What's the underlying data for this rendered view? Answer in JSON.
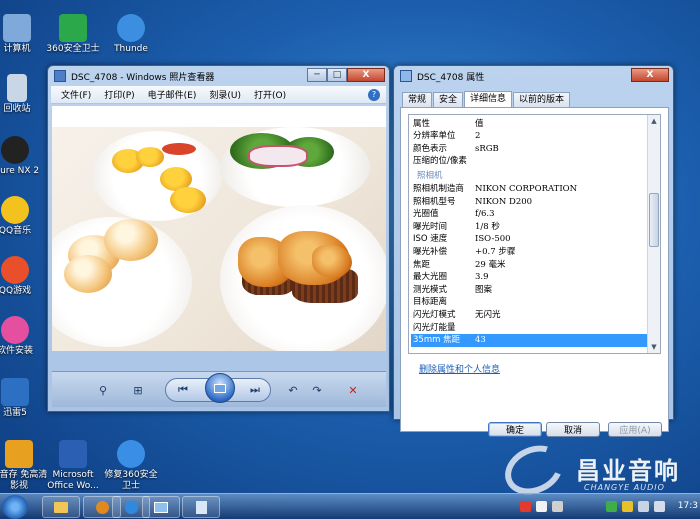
{
  "desktop_icons": [
    {
      "label": "计算机",
      "color": "#7fa9d9"
    },
    {
      "label": "360安全卫士",
      "color": "#2aa84a"
    },
    {
      "label": "Thunde",
      "color": "#3b8ee0"
    },
    {
      "label": "回收站",
      "color": "#c8d6e6"
    },
    {
      "label": "pture NX 2",
      "color": "#222222"
    },
    {
      "label": "QQ音乐",
      "color": "#f4c21f"
    },
    {
      "label": "QQ游戏",
      "color": "#e94f2a"
    },
    {
      "label": "软件安装",
      "color": "#e44fa0"
    },
    {
      "label": "迅雷5",
      "color": "#2d6fc3"
    },
    {
      "label": "暴音存 免高清影视",
      "color": "#e8a020"
    },
    {
      "label": "Microsoft Office Wo...",
      "color": "#2b5fb3"
    },
    {
      "label": "修复360安全卫士",
      "color": "#3a8ee6"
    }
  ],
  "photo_viewer": {
    "title": "DSC_4708 - Windows 照片查看器",
    "menu": [
      "文件(F)",
      "打印(P)",
      "电子邮件(E)",
      "刻录(U)",
      "打开(O)"
    ],
    "help": "?",
    "controls": {
      "minimize": "─",
      "maximize": "□",
      "close": "X"
    },
    "toolbar_icons": [
      "zoom-icon",
      "actual-size-icon",
      "previous-icon",
      "slideshow-icon",
      "next-icon",
      "rotate-ccw-icon",
      "rotate-cw-icon",
      "delete-icon"
    ],
    "toolbar_glyphs": {
      "zoom": "⚲",
      "actual": "⊞",
      "prev": "⏮",
      "next": "⏭",
      "rot_ccw": "↶",
      "rot_cw": "↷",
      "delete": "✕"
    }
  },
  "properties": {
    "title": "DSC_4708 属性",
    "close": "X",
    "tabs": [
      "常规",
      "安全",
      "详细信息",
      "以前的版本"
    ],
    "active_tab": 2,
    "header": {
      "k": "属性",
      "v": "值"
    },
    "rows_top": [
      {
        "k": "分辨率单位",
        "v": "2"
      },
      {
        "k": "颜色表示",
        "v": "sRGB"
      },
      {
        "k": "压缩的位/像素",
        "v": ""
      }
    ],
    "section": "照相机",
    "rows": [
      {
        "k": "照相机制造商",
        "v": "NIKON CORPORATION"
      },
      {
        "k": "照相机型号",
        "v": "NIKON D200"
      },
      {
        "k": "光圈值",
        "v": "f/6.3"
      },
      {
        "k": "曝光时间",
        "v": "1/8 秒"
      },
      {
        "k": "ISO 速度",
        "v": "ISO-500"
      },
      {
        "k": "曝光补偿",
        "v": "+0.7 步骤"
      },
      {
        "k": "焦距",
        "v": "29 毫米"
      },
      {
        "k": "最大光圈",
        "v": "3.9"
      },
      {
        "k": "测光模式",
        "v": "图案"
      },
      {
        "k": "目标距离",
        "v": ""
      },
      {
        "k": "闪光灯模式",
        "v": "无闪光"
      },
      {
        "k": "闪光灯能量",
        "v": ""
      },
      {
        "k": "35mm 焦距",
        "v": "43"
      }
    ],
    "selected_row": 12,
    "link": "删除属性和个人信息",
    "buttons": {
      "ok": "确定",
      "cancel": "取消",
      "apply": "应用(A)"
    }
  },
  "watermark": {
    "cn": "昌业音响",
    "en": "CHANGYE AUDIO"
  },
  "taskbar": {
    "clock": "17:3"
  }
}
